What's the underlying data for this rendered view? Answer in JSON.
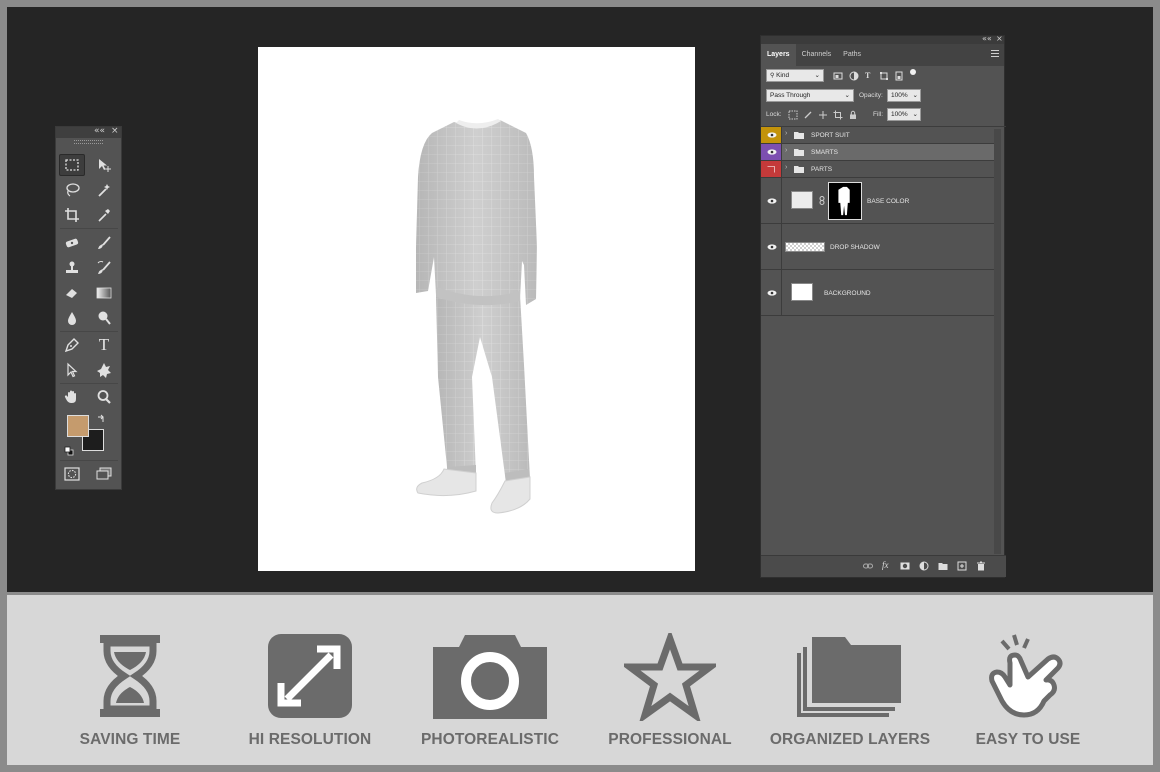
{
  "tools_panel": {
    "collapse_label": "««",
    "close_label": "×",
    "foreground_color": "#c59b6d",
    "background_color": "#1d1d1d",
    "tools": [
      "rectangular-marquee-icon",
      "move-icon",
      "lasso-icon",
      "magic-wand-icon",
      "crop-icon",
      "eyedropper-icon",
      "healing-brush-icon",
      "brush-icon",
      "clone-stamp-icon",
      "history-brush-icon",
      "eraser-icon",
      "gradient-icon",
      "blur-icon",
      "dodge-icon",
      "pen-icon",
      "type-icon",
      "path-selection-icon",
      "custom-shape-icon",
      "hand-icon",
      "zoom-icon"
    ],
    "type_tool_glyph": "T"
  },
  "layers_panel": {
    "collapse_label": "««",
    "close_label": "×",
    "tabs": [
      {
        "label": "Layers",
        "active": true
      },
      {
        "label": "Channels",
        "active": false
      },
      {
        "label": "Paths",
        "active": false
      }
    ],
    "filter_kind": "Kind",
    "blend_mode": "Pass Through",
    "opacity_label": "Opacity:",
    "opacity_value": "100%",
    "lock_label": "Lock:",
    "fill_label": "Fill:",
    "fill_value": "100%",
    "layers": [
      {
        "name": "SPORT SUIT",
        "type": "group",
        "color": "#c3930b"
      },
      {
        "name": "SMARTS",
        "type": "group",
        "color": "#7c4fb0",
        "selected": true
      },
      {
        "name": "PARTS",
        "type": "group",
        "color": "#c43a3a",
        "hidden": true
      },
      {
        "name": "BASE COLOR",
        "type": "layer-with-mask"
      },
      {
        "name": "DROP SHADOW",
        "type": "layer-transparent"
      },
      {
        "name": "BACKGROUND",
        "type": "layer"
      }
    ],
    "bottom_icons": [
      "link-icon",
      "fx-icon",
      "mask-icon",
      "adjustment-icon",
      "group-icon",
      "new-layer-icon",
      "trash-icon"
    ],
    "fx_label": "fx"
  },
  "features": [
    {
      "label": "SAVING TIME",
      "icon": "hourglass-icon"
    },
    {
      "label": "HI RESOLUTION",
      "icon": "expand-arrows-icon"
    },
    {
      "label": "PHOTOREALISTIC",
      "icon": "camera-icon"
    },
    {
      "label": "PROFESSIONAL",
      "icon": "star-icon"
    },
    {
      "label": "ORGANIZED LAYERS",
      "icon": "layers-folder-icon"
    },
    {
      "label": "EASY TO USE",
      "icon": "tap-hand-icon"
    }
  ],
  "colors": {
    "workspace": "#252525",
    "panel": "#535353",
    "feature_strip": "#d7d7d7",
    "feature_icon": "#6b6b6b"
  }
}
